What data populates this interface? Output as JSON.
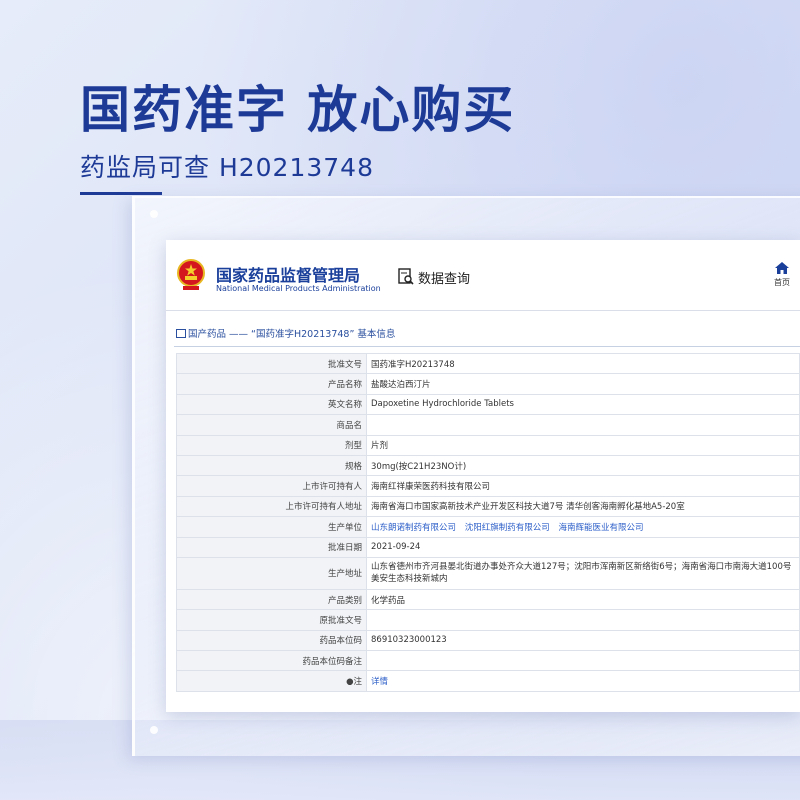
{
  "hero": {
    "headline": "国药准字 放心购买",
    "subline": "药监局可查 H20213748"
  },
  "site": {
    "name_cn": "国家药品监督管理局",
    "name_en": "National Medical Products Administration",
    "data_query": "数据查询",
    "home": "首页"
  },
  "breadcrumb": "国产药品 —— “国药准字H20213748” 基本信息",
  "table": {
    "rows": [
      {
        "key": "批准文号",
        "value": "国药准字H20213748"
      },
      {
        "key": "产品名称",
        "value": "盐酸达泊西汀片"
      },
      {
        "key": "英文名称",
        "value": "Dapoxetine Hydrochloride Tablets"
      },
      {
        "key": "商品名",
        "value": ""
      },
      {
        "key": "剂型",
        "value": "片剂"
      },
      {
        "key": "规格",
        "value": "30mg(按C21H23NO计)"
      },
      {
        "key": "上市许可持有人",
        "value": "海南红祥康荣医药科技有限公司"
      },
      {
        "key": "上市许可持有人地址",
        "value": "海南省海口市国家高新技术产业开发区科技大道7号 清华创客海南孵化基地A5-20室"
      },
      {
        "key": "生产单位",
        "links": [
          "山东朗诺制药有限公司",
          "沈阳红旗制药有限公司",
          "海南辉能医业有限公司"
        ]
      },
      {
        "key": "批准日期",
        "value": "2021-09-24"
      },
      {
        "key": "生产地址",
        "value": "山东省德州市齐河县晏北街道办事处齐众大道127号；沈阳市浑南新区新络街6号；海南省海口市南海大道100号美安生态科技新城内"
      },
      {
        "key": "产品类别",
        "value": "化学药品"
      },
      {
        "key": "原批准文号",
        "value": ""
      },
      {
        "key": "药品本位码",
        "value": "86910323000123"
      },
      {
        "key": "药品本位码备注",
        "value": ""
      },
      {
        "key": "●注",
        "link": "详情"
      }
    ]
  },
  "colors": {
    "brand_blue": "#1d3a97",
    "link_blue": "#2d5fc8"
  },
  "icons": [
    "national-emblem-icon",
    "search-icon",
    "home-icon"
  ]
}
